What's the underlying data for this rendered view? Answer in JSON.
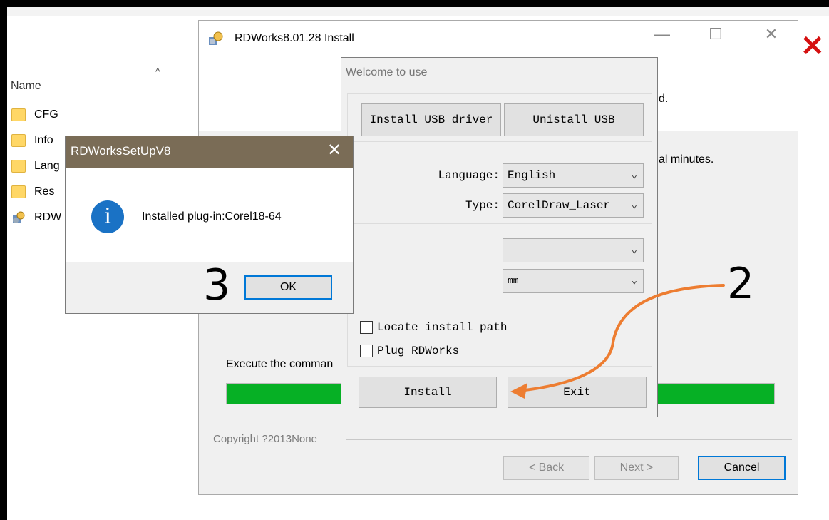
{
  "explorer": {
    "column_header": "Name",
    "sort_caret": "^",
    "items": [
      {
        "label": "CFG",
        "icon": "folder-icon"
      },
      {
        "label": "Info",
        "icon": "folder-icon"
      },
      {
        "label": "Lang",
        "icon": "folder-icon"
      },
      {
        "label": "Res",
        "icon": "folder-icon"
      },
      {
        "label": "RDW",
        "icon": "installer-file-icon"
      }
    ],
    "error_mark": "✕"
  },
  "installer": {
    "title": "RDWorks8.01.28 Install",
    "minimize": "—",
    "maximize": "☐",
    "close": "✕",
    "fragment_text_1": "d.",
    "fragment_text_2": "al minutes.",
    "execute_label": "Execute the comman",
    "progress_percent": 100,
    "progress_color": "#06b025",
    "copyright": "Copyright ?2013None",
    "back_label": "< Back",
    "next_label": "Next >",
    "cancel_label": "Cancel"
  },
  "welcome": {
    "title": "Welcome to use",
    "install_usb_label": "Install USB driver",
    "uninstall_usb_label": "Unistall USB",
    "language_label": "Language:",
    "language_value": "English",
    "type_label": "Type:",
    "type_value": "CorelDraw_Laser",
    "combo3_value": "",
    "unit_value": "mm",
    "locate_path_label": "Locate install path",
    "plug_label": "Plug RDWorks",
    "install_label": "Install",
    "exit_label": "Exit"
  },
  "msgbox": {
    "title": "RDWorksSetUpV8",
    "close": "✕",
    "icon_glyph": "i",
    "message": "Installed plug-in:Corel18-64",
    "ok_label": "OK"
  },
  "annotations": {
    "step_2": "2",
    "step_3": "3",
    "arrow_color": "#ed7d31"
  }
}
